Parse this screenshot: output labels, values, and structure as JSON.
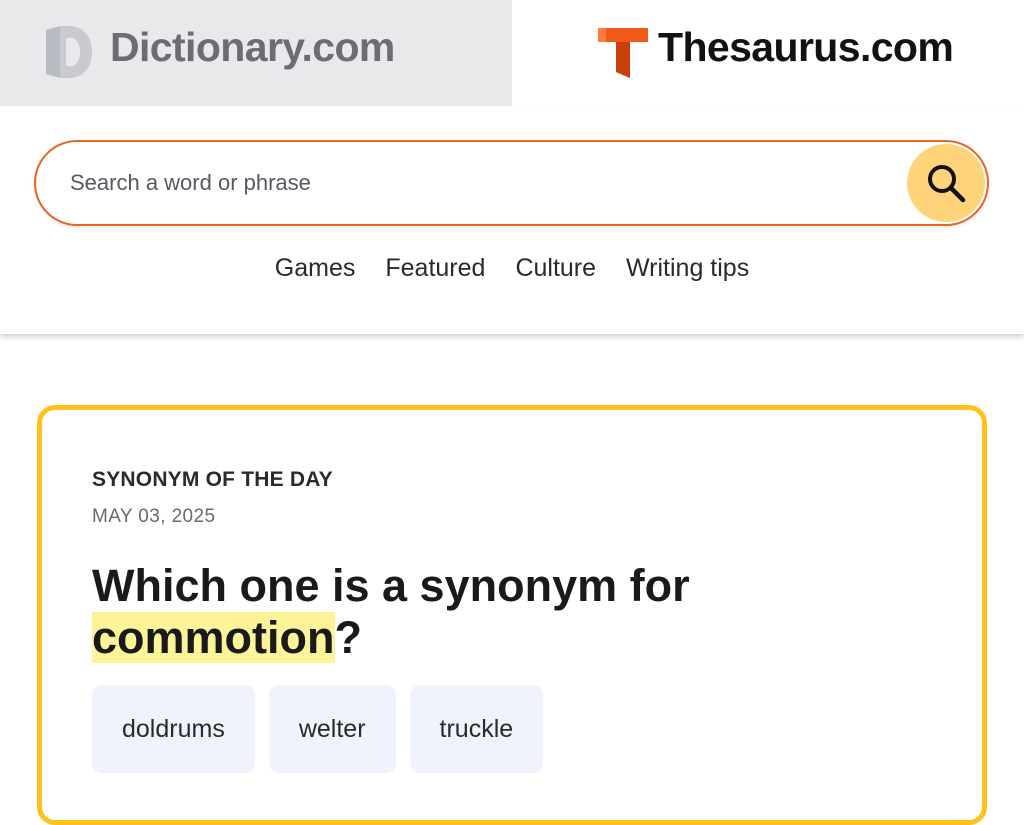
{
  "site_tabs": {
    "dictionary": {
      "label": "Dictionary.com",
      "icon": "dictionary-logo-icon"
    },
    "thesaurus": {
      "label": "Thesaurus.com",
      "icon": "thesaurus-logo-icon"
    }
  },
  "search": {
    "placeholder": "Search a word or phrase",
    "button_icon": "search-icon"
  },
  "nav": {
    "items": [
      "Games",
      "Featured",
      "Culture",
      "Writing tips"
    ]
  },
  "synonym_of_the_day": {
    "eyebrow": "SYNONYM OF THE DAY",
    "date": "MAY 03, 2025",
    "question_prefix": "Which one is a synonym for",
    "word": "commotion",
    "question_suffix": "?",
    "options": [
      "doldrums",
      "welter",
      "truckle"
    ]
  },
  "colors": {
    "accent_orange": "#e86523",
    "card_border": "#ffc21a",
    "search_button": "#ffd37a",
    "highlight": "#fdf49a",
    "option_bg": "#eef3fc"
  }
}
